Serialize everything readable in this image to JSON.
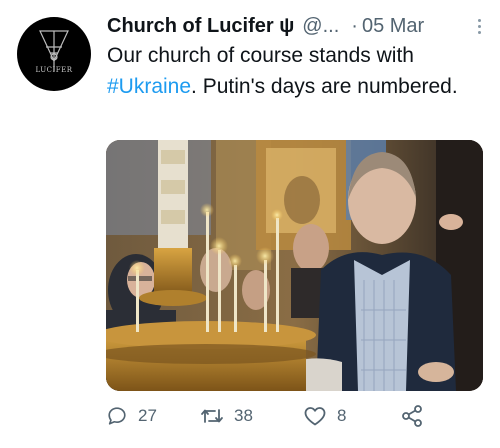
{
  "avatar": {
    "logo_text": "LUCIFER",
    "logo_icon": "sigil-of-lucifer-icon"
  },
  "tweet": {
    "author_name": "Church of Lucifer ψ",
    "handle": "@...",
    "separator": "·",
    "date": "05 Mar",
    "text_before": "Our church of course stands with ",
    "hashtag": "#Ukraine",
    "text_after": ". Putin's days are numbered."
  },
  "actions": {
    "reply_icon": "reply-icon",
    "reply_count": "27",
    "retweet_icon": "retweet-icon",
    "retweet_count": "38",
    "like_icon": "heart-icon",
    "like_count": "8",
    "share_icon": "share-icon"
  },
  "colors": {
    "text": "#0f1419",
    "secondary": "#536471",
    "link": "#1d9bf0",
    "icon": "#536471"
  }
}
